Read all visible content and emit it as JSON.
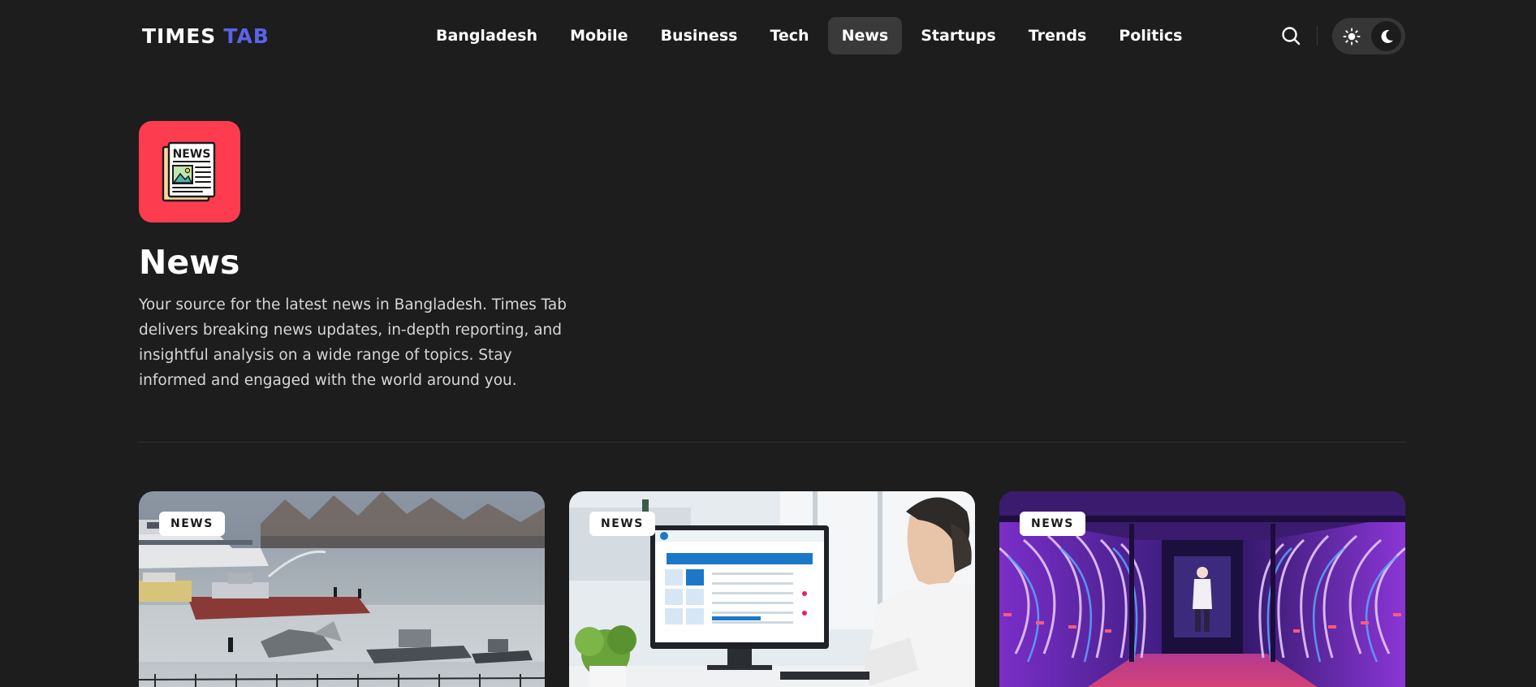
{
  "header": {
    "logo": {
      "word1": "TIMES",
      "word2": "TAB"
    },
    "nav": [
      {
        "label": "Bangladesh"
      },
      {
        "label": "Mobile"
      },
      {
        "label": "Business"
      },
      {
        "label": "Tech"
      },
      {
        "label": "News",
        "active": true
      },
      {
        "label": "Startups"
      },
      {
        "label": "Trends"
      },
      {
        "label": "Politics"
      }
    ],
    "icons": {
      "search": "search-icon",
      "light_mode": "sun-icon",
      "dark_mode": "moon-icon"
    },
    "theme_selected": "dark"
  },
  "category": {
    "icon": "newspaper-icon",
    "icon_text": "NEWS",
    "title": "News",
    "description": "Your source for the latest news in Bangladesh. Times Tab delivers breaking news updates, in-depth reporting, and insightful analysis on a wide range of topics. Stay informed and engaged with the world around you."
  },
  "cards": [
    {
      "badge": "NEWS",
      "image": "river-rescue-boats-photo"
    },
    {
      "badge": "NEWS",
      "image": "office-computer-screen-photo"
    },
    {
      "badge": "NEWS",
      "image": "data-center-neon-photo"
    }
  ],
  "colors": {
    "background": "#1d1d1d",
    "accent_blue": "#5b63e8",
    "category_red": "#fd3c4f",
    "nav_active": "#3a3a3a",
    "text_muted": "#d6d6d6"
  }
}
